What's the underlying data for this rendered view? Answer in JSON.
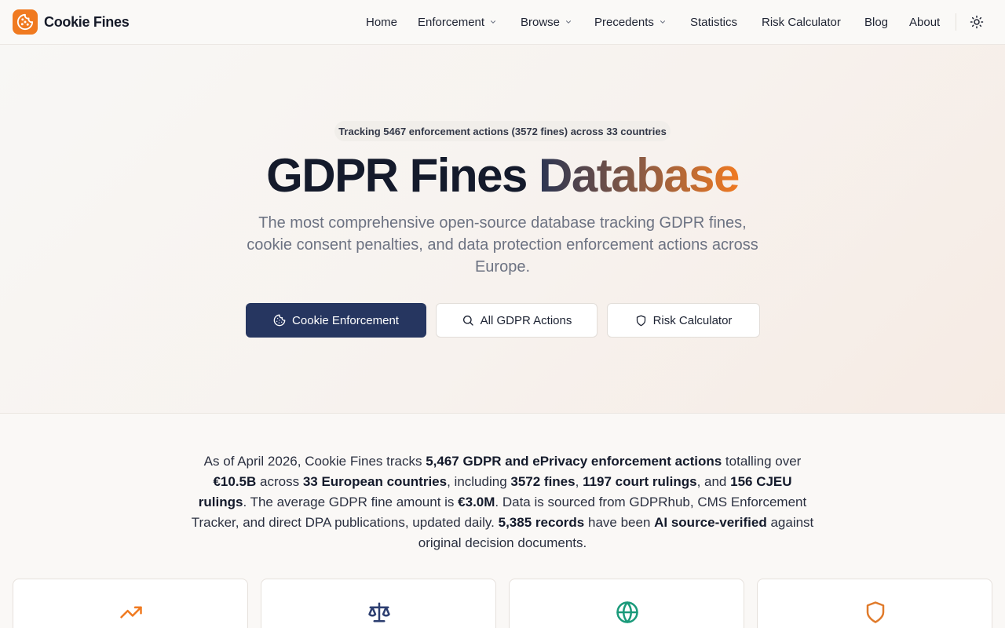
{
  "brand": {
    "name": "Cookie Fines"
  },
  "nav": {
    "home": "Home",
    "enforcement": "Enforcement",
    "browse": "Browse",
    "precedents": "Precedents",
    "statistics": "Statistics",
    "risk_calculator": "Risk Calculator",
    "blog": "Blog",
    "about": "About"
  },
  "hero": {
    "tracking": "Tracking 5467 enforcement actions (3572 fines) across 33 countries",
    "title_main": "GDPR Fines ",
    "title_accent": "Database",
    "subtitle": "The most comprehensive open-source database tracking GDPR fines, cookie consent penalties, and data protection enforcement actions across Europe.",
    "buttons": {
      "cookie": "Cookie Enforcement",
      "all_actions": "All GDPR Actions",
      "risk": "Risk Calculator"
    }
  },
  "summary": {
    "t1": "As of April 2026, Cookie Fines tracks ",
    "b1": "5,467 GDPR and ePrivacy enforcement actions",
    "t2": " totalling over ",
    "b2": "€10.5B",
    "t3": " across ",
    "b3": "33 European countries",
    "t4": ", including ",
    "b4": "3572 fines",
    "t5": ", ",
    "b5": "1197 court rulings",
    "t6": ", and ",
    "b6": "156 CJEU rulings",
    "t7": ". The average GDPR fine amount is ",
    "b7": "€3.0M",
    "t8": ". Data is sourced from GDPRhub, CMS Enforcement Tracker, and direct DPA publications, updated daily. ",
    "b8": "5,385 records",
    "t9": " have been ",
    "b9": "AI source-verified",
    "t10": " against original decision documents."
  },
  "cards": [
    {
      "icon": "trending-up-icon",
      "color": "#f07a20"
    },
    {
      "icon": "scale-icon",
      "color": "#2c3e70"
    },
    {
      "icon": "globe-icon",
      "color": "#1a9a7a"
    },
    {
      "icon": "shield-icon",
      "color": "#e07a2a"
    }
  ],
  "colors": {
    "accent": "#f07a20",
    "primary_button": "#263660"
  }
}
